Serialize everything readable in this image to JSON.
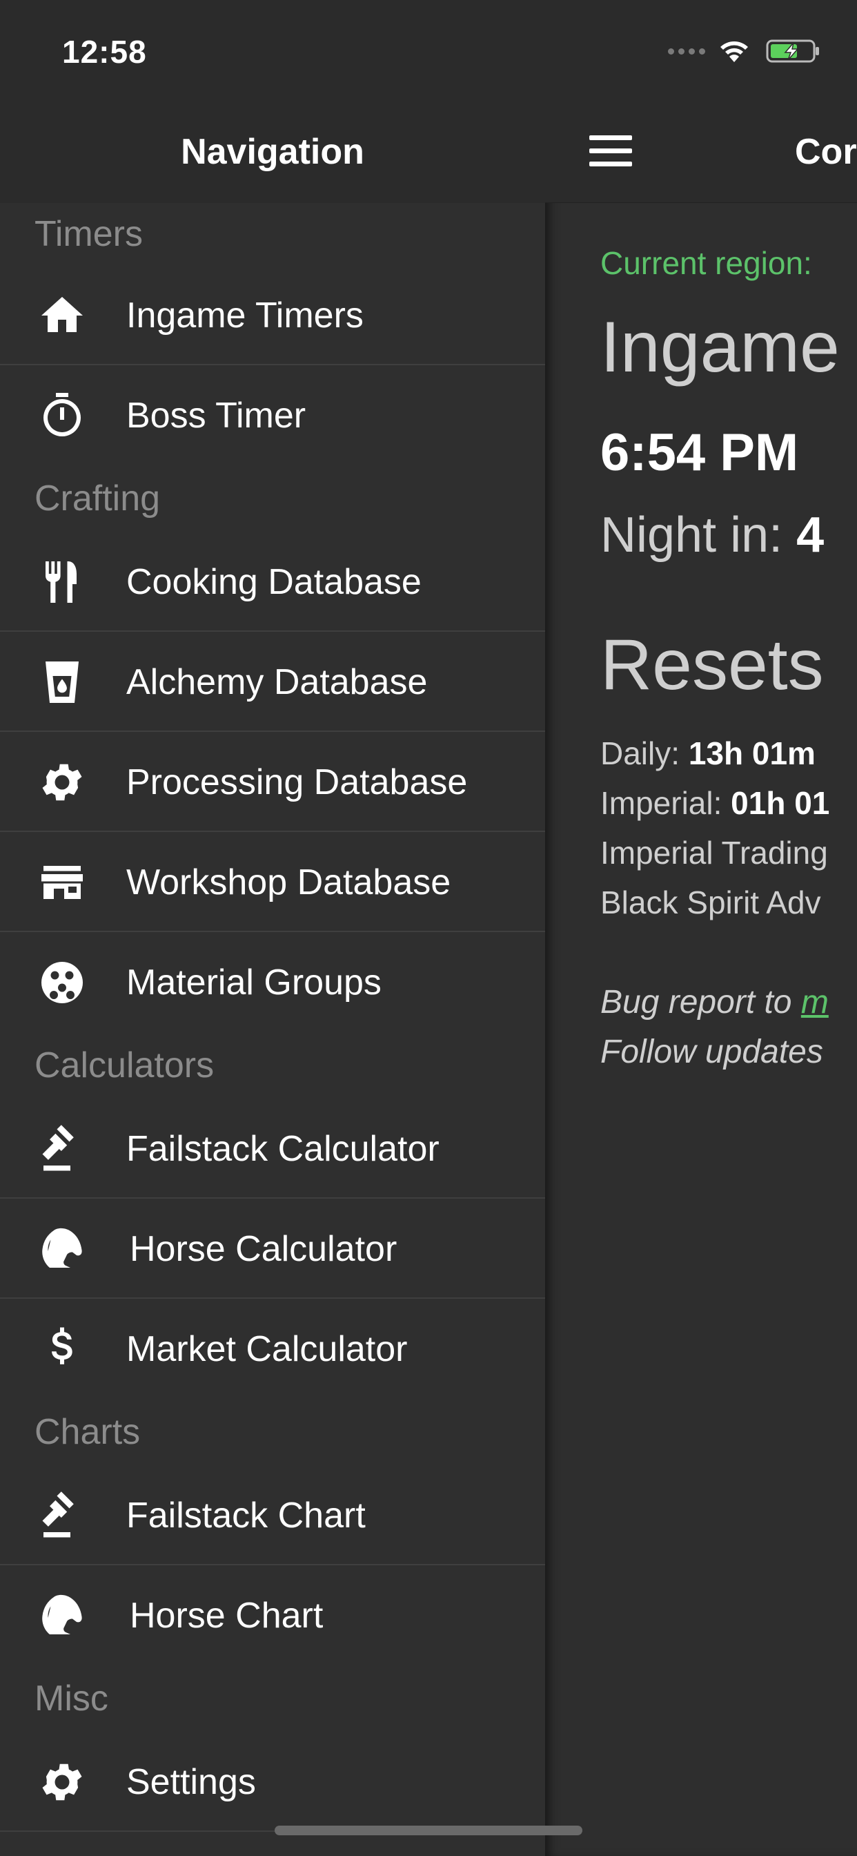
{
  "status": {
    "time": "12:58"
  },
  "drawer": {
    "title": "Navigation",
    "sections": {
      "timers": "Timers",
      "crafting": "Crafting",
      "calculators": "Calculators",
      "charts": "Charts",
      "misc": "Misc"
    },
    "items": {
      "ingame_timers": {
        "label": "Ingame Timers",
        "icon": "home-icon"
      },
      "boss_timer": {
        "label": "Boss Timer",
        "icon": "stopwatch-icon"
      },
      "cooking_db": {
        "label": "Cooking Database",
        "icon": "utensils-icon"
      },
      "alchemy_db": {
        "label": "Alchemy Database",
        "icon": "flask-icon"
      },
      "processing_db": {
        "label": "Processing Database",
        "icon": "gear-icon"
      },
      "workshop_db": {
        "label": "Workshop Database",
        "icon": "store-icon"
      },
      "material_groups": {
        "label": "Material Groups",
        "icon": "cookie-icon"
      },
      "failstack_calc": {
        "label": "Failstack Calculator",
        "icon": "gavel-icon"
      },
      "horse_calc": {
        "label": "Horse Calculator",
        "icon": "horse-icon"
      },
      "market_calc": {
        "label": "Market Calculator",
        "icon": "dollar-icon"
      },
      "failstack_chart": {
        "label": "Failstack Chart",
        "icon": "gavel-icon"
      },
      "horse_chart": {
        "label": "Horse Chart",
        "icon": "horse-icon"
      },
      "settings": {
        "label": "Settings",
        "icon": "gear-icon"
      }
    }
  },
  "main": {
    "title_partial": "Cor",
    "region_label": "Current region:",
    "ingame_heading": "Ingame",
    "ingame_time": "6:54 PM",
    "night_label": "Night in:",
    "night_value": "4",
    "resets_heading": "Resets",
    "daily_label": "Daily:",
    "daily_value": "13h 01m",
    "imperial_label": "Imperial:",
    "imperial_value": "01h 01",
    "imperial_trading": "Imperial Trading",
    "black_spirit": "Black Spirit Adv",
    "bug_report": "Bug report to",
    "bug_link": "m",
    "follow_updates": "Follow updates"
  },
  "colors": {
    "accent_green": "#5cc26a",
    "section_gray": "#8c8c8c",
    "background": "#2f2f2f"
  }
}
